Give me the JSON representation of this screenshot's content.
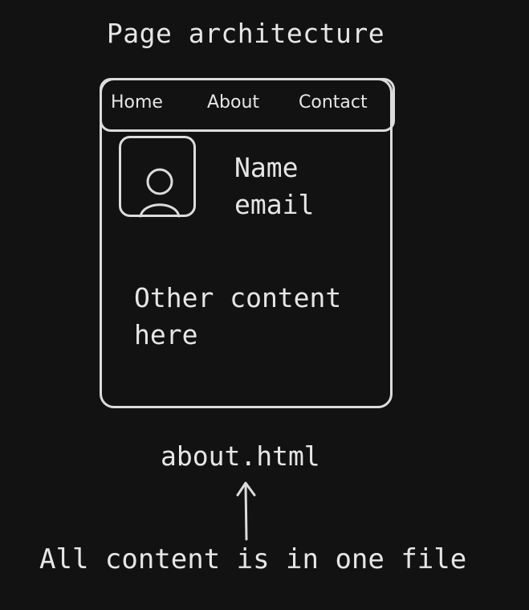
{
  "title": "Page architecture",
  "nav": {
    "items": [
      {
        "label": "Home"
      },
      {
        "label": "About"
      },
      {
        "label": "Contact"
      }
    ]
  },
  "profile": {
    "name": "Name",
    "email": "email",
    "avatar_icon": "user-avatar-icon"
  },
  "content": {
    "text": "Other content here"
  },
  "file": {
    "name": "about.html"
  },
  "caption": "All content is in one file",
  "colors": {
    "background": "#121212",
    "stroke": "#dcdcdc",
    "text": "#e6e6e6"
  }
}
